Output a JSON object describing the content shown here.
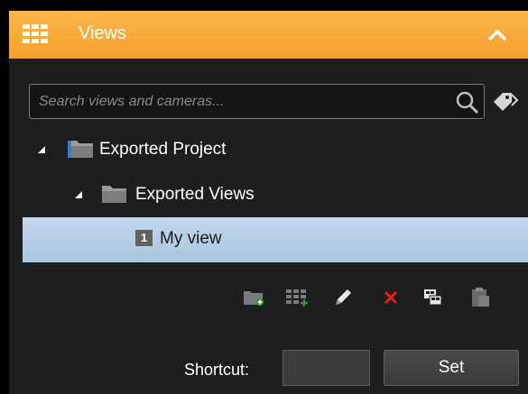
{
  "panel": {
    "title": "Views",
    "header_icon": "grid-icon",
    "collapse_icon": "chevron-up-icon"
  },
  "search": {
    "placeholder": "Search views and cameras...",
    "value": ""
  },
  "tree": {
    "items": [
      {
        "label": "Exported Project",
        "icon": "folder-icon",
        "expanded": true
      },
      {
        "label": "Exported Views",
        "icon": "folder-icon",
        "expanded": true
      },
      {
        "label": "My view",
        "badge": "1",
        "selected": true
      }
    ]
  },
  "toolbar": {
    "buttons": [
      "new-group-icon",
      "new-view-icon",
      "edit-icon",
      "delete-icon",
      "copy-icon",
      "paste-icon"
    ]
  },
  "shortcut": {
    "label": "Shortcut:",
    "value": "",
    "set_label": "Set"
  },
  "colors": {
    "header": "#f5a02e",
    "selection": "#b4cde5",
    "delete": "#e0201e"
  }
}
